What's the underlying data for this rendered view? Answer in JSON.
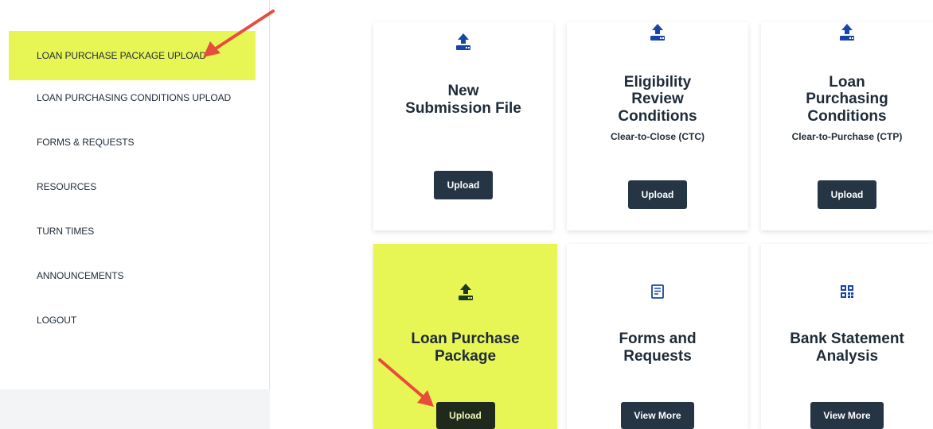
{
  "sidebar": {
    "items": [
      {
        "label": "LOAN PURCHASE PACKAGE UPLOAD"
      },
      {
        "label": "LOAN PURCHASING CONDITIONS UPLOAD"
      },
      {
        "label": "FORMS & REQUESTS"
      },
      {
        "label": "RESOURCES"
      },
      {
        "label": "TURN TIMES"
      },
      {
        "label": "ANNOUNCEMENTS"
      },
      {
        "label": "LOGOUT"
      }
    ]
  },
  "cards": [
    {
      "title1": "New",
      "title2": "Submission File",
      "button": "Upload",
      "icon": "upload-icon"
    },
    {
      "title1": "Eligibility",
      "title2": "Review",
      "title3": "Conditions",
      "subtitle": "Clear-to-Close (CTC)",
      "button": "Upload",
      "icon": "upload-icon"
    },
    {
      "title1": "Loan",
      "title2": "Purchasing",
      "title3": "Conditions",
      "subtitle": "Clear-to-Purchase (CTP)",
      "button": "Upload",
      "icon": "upload-icon"
    },
    {
      "title1": "Loan Purchase",
      "title2": "Package",
      "button": "Upload",
      "icon": "upload-icon"
    },
    {
      "title1": "Forms and",
      "title2": "Requests",
      "button": "View More",
      "icon": "form-icon"
    },
    {
      "title1": "Bank Statement",
      "title2": "Analysis",
      "button": "View More",
      "icon": "qr-code-icon"
    }
  ],
  "colors": {
    "highlight": "#e8f655",
    "button": "#263544",
    "icon_blue": "#1846a8",
    "annotation_arrow": "#e84c3d"
  }
}
